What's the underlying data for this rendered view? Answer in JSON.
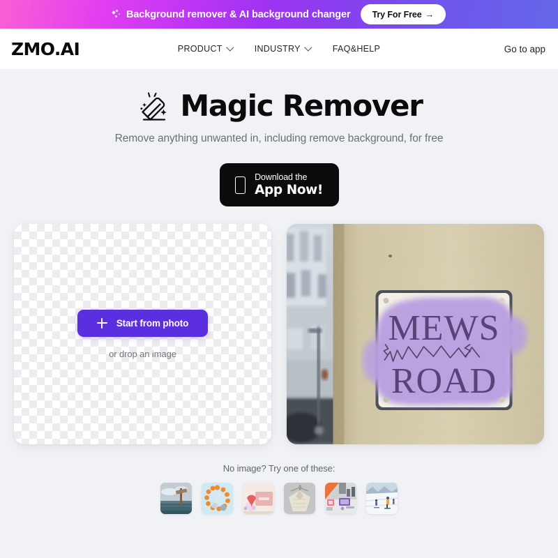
{
  "promo": {
    "icon": "sparkle-icon",
    "text": "Background remover & AI background changer",
    "cta_label": "Try For Free",
    "cta_arrow": "→",
    "gradient_from": "#fb5fd4",
    "gradient_mid": "#a033f2",
    "gradient_to": "#6668ea"
  },
  "nav": {
    "brand": "ZMO.AI",
    "items": [
      {
        "label": "PRODUCT",
        "has_dropdown": true
      },
      {
        "label": "INDUSTRY",
        "has_dropdown": true
      },
      {
        "label": "FAQ&HELP",
        "has_dropdown": false
      }
    ],
    "right_link": "Go to app"
  },
  "hero": {
    "icon": "magic-eraser-icon",
    "title": "Magic Remover",
    "subtitle": "Remove anything unwanted in, including remove background, for free"
  },
  "download": {
    "icon": "phone-icon",
    "line1": "Download the",
    "line2": "App Now!",
    "bg_color": "#0b0b0b"
  },
  "uploader": {
    "plus_icon": "plus-icon",
    "button_label": "Start from photo",
    "button_color": "#5b2ee0",
    "drop_hint": "or drop an image"
  },
  "preview": {
    "alt": "Street sign reading MEWS ROAD on a stucco wall with a purple magic-remover brush selection",
    "sign_line1": "MEWS",
    "sign_line2": "ROAD",
    "brush_color": "#b9a0e0",
    "wall_color": "#d6cba6"
  },
  "samples": {
    "label": "No image? Try one of these:",
    "thumbs": [
      {
        "name": "thumb-landscape-sign",
        "alt": "Coastal landscape with wooden signpost"
      },
      {
        "name": "thumb-oranges-circle",
        "alt": "Oranges arranged in a circle on light blue"
      },
      {
        "name": "thumb-gift-box",
        "alt": "Pink gift box with flowers"
      },
      {
        "name": "thumb-sweater",
        "alt": "Cream knit sweater on a hanger"
      },
      {
        "name": "thumb-desk-tablet",
        "alt": "Desk with tablet and stationery"
      },
      {
        "name": "thumb-skiers-snow",
        "alt": "Skiers on a snowy slope"
      }
    ]
  }
}
